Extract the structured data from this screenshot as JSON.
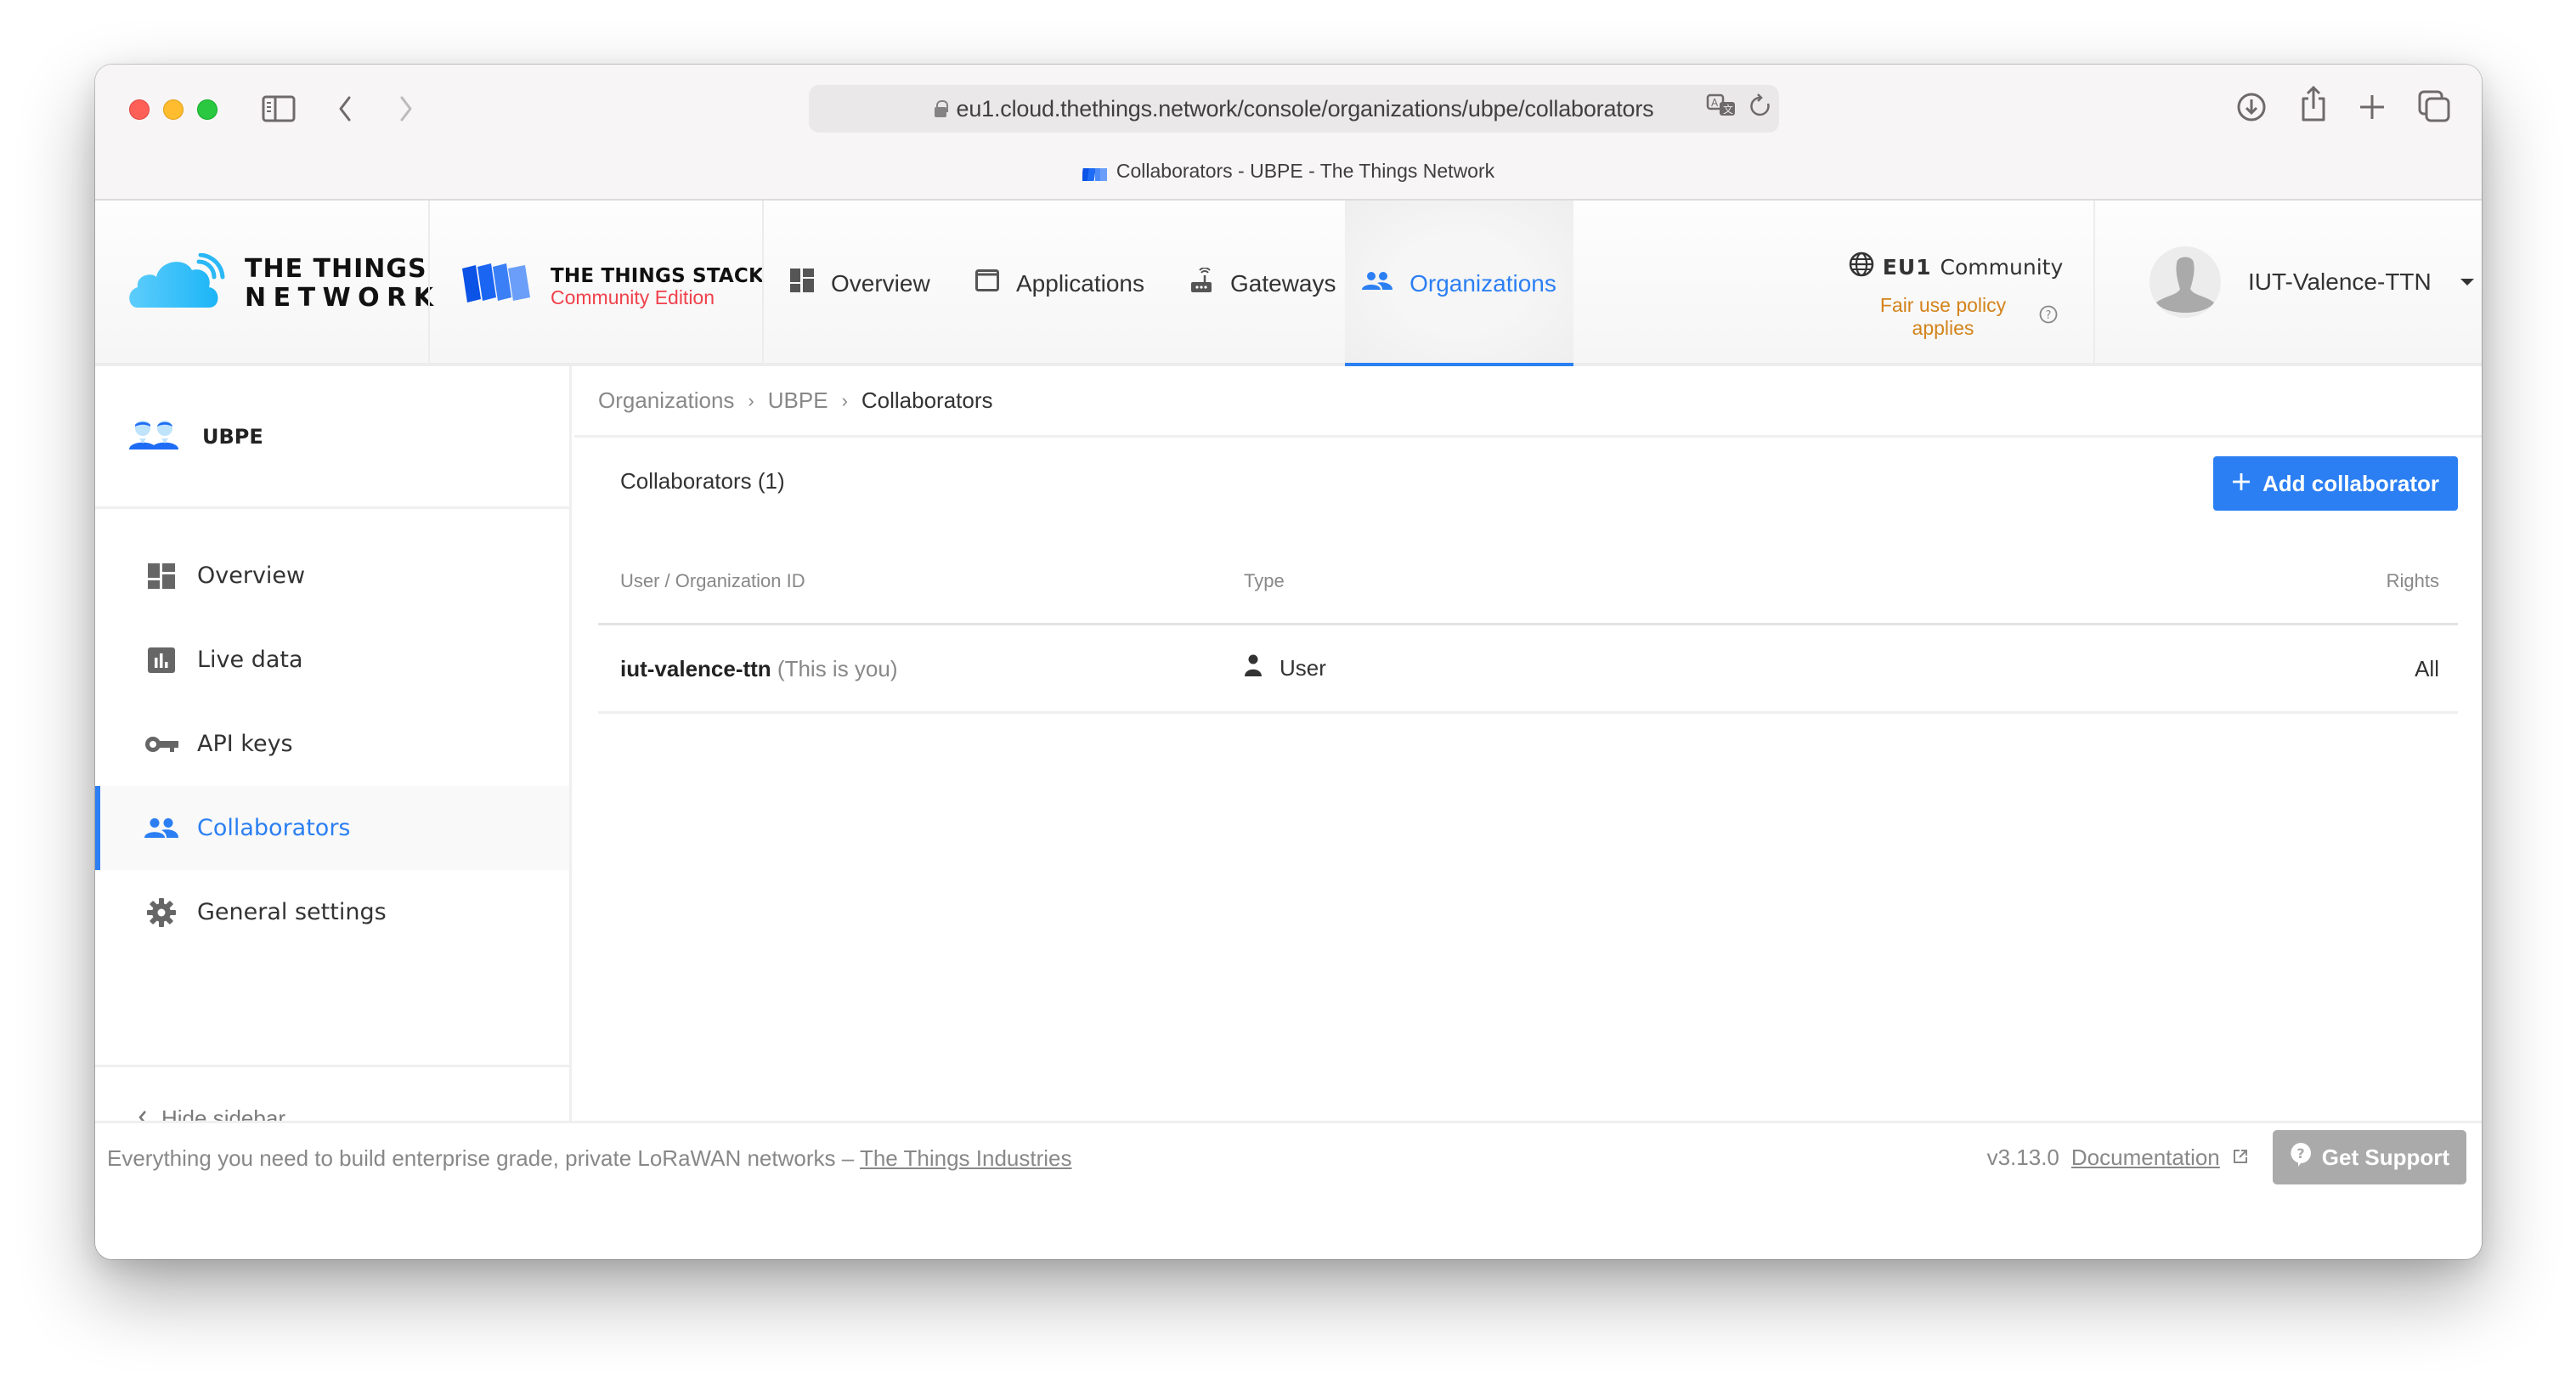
{
  "browser": {
    "url": "eu1.cloud.thethings.network/console/organizations/ubpe/collaborators",
    "tab_title": "Collaborators - UBPE - The Things Network"
  },
  "header": {
    "ttn_logo": {
      "line1": "THE THINGS",
      "line2": "NETWORK"
    },
    "tts_logo": {
      "line1": "THE THINGS STACK",
      "line2": "Community Edition"
    },
    "nav": [
      {
        "label": "Overview",
        "icon": "dashboard-icon",
        "active": false
      },
      {
        "label": "Applications",
        "icon": "application-icon",
        "active": false
      },
      {
        "label": "Gateways",
        "icon": "gateway-icon",
        "active": false
      },
      {
        "label": "Organizations",
        "icon": "organization-icon",
        "active": true
      }
    ],
    "cluster": {
      "region": "EU1",
      "label": "Community",
      "fair_use": "Fair use policy applies"
    },
    "user": {
      "name": "IUT-Valence-TTN"
    }
  },
  "sidebar": {
    "entity_name": "UBPE",
    "items": [
      {
        "label": "Overview",
        "icon": "dashboard-icon",
        "active": false
      },
      {
        "label": "Live data",
        "icon": "live-data-icon",
        "active": false
      },
      {
        "label": "API keys",
        "icon": "key-icon",
        "active": false
      },
      {
        "label": "Collaborators",
        "icon": "collaborators-icon",
        "active": true
      },
      {
        "label": "General settings",
        "icon": "gear-icon",
        "active": false
      }
    ],
    "hide_label": "Hide sidebar"
  },
  "main": {
    "breadcrumb": [
      "Organizations",
      "UBPE",
      "Collaborators"
    ],
    "section_title": "Collaborators (1)",
    "add_button": "Add collaborator",
    "table": {
      "columns": [
        "User / Organization ID",
        "Type",
        "Rights"
      ],
      "rows": [
        {
          "id": "iut-valence-ttn",
          "note": "(This is you)",
          "type": "User",
          "rights": "All"
        }
      ]
    }
  },
  "footer": {
    "tagline": "Everything you need to build enterprise grade, private LoRaWAN networks –",
    "tagline_link": "The Things Industries",
    "version": "v3.13.0",
    "docs_link": "Documentation",
    "support_button": "Get Support"
  },
  "colors": {
    "accent": "#2b7ff3",
    "brand_red": "#f0414b",
    "warning": "#d3831a",
    "support_button": "#aaaaaa"
  }
}
